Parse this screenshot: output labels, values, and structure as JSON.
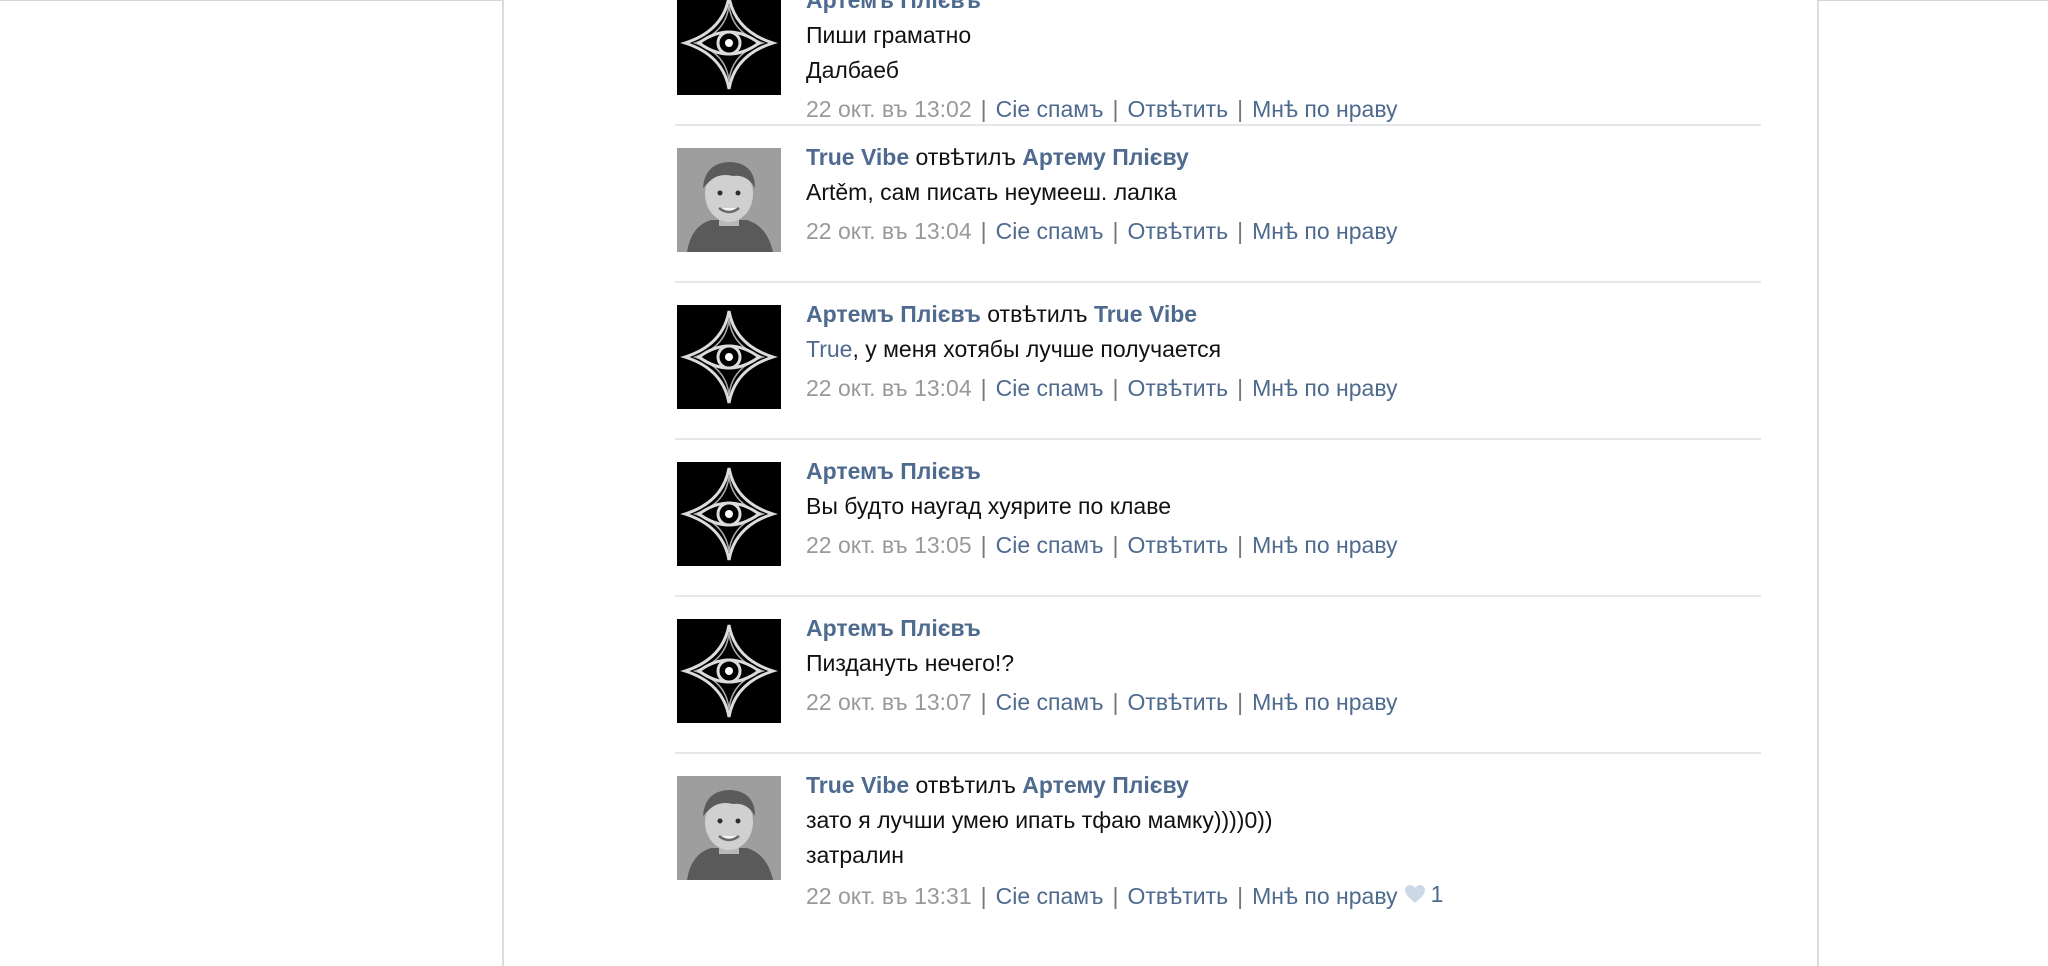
{
  "separator": "|",
  "actions": {
    "spam": "Сіе спамъ",
    "reply": "Отвѣтить",
    "like": "Мнѣ по нраву"
  },
  "comments": [
    {
      "author": "Артемъ Плієвъ",
      "avatar": "star-emblem-icon",
      "lines": [
        "Пиши граматно",
        "Далбаеб"
      ],
      "time": "22 окт. въ 13:02"
    },
    {
      "author": "True Vibe",
      "replied": "отвѣтилъ",
      "target": "Артему Плієву",
      "avatar": "user-photo",
      "lines": [
        "Artěm, сам писать неумееш. лалка"
      ],
      "time": "22 окт. въ 13:04"
    },
    {
      "author": "Артемъ Плієвъ",
      "replied": "отвѣтилъ",
      "target": "True Vibe",
      "avatar": "star-emblem-icon",
      "mention": "True",
      "line_rest": ", у меня хотябы лучше получается",
      "time": "22 окт. въ 13:04"
    },
    {
      "author": "Артемъ Плієвъ",
      "avatar": "star-emblem-icon",
      "lines": [
        "Вы будто наугад хуярите по клаве"
      ],
      "time": "22 окт. въ 13:05"
    },
    {
      "author": "Артемъ Плієвъ",
      "avatar": "star-emblem-icon",
      "lines": [
        "Пиздануть нечего!?"
      ],
      "time": "22 окт. въ 13:07"
    },
    {
      "author": "True Vibe",
      "replied": "отвѣтилъ",
      "target": "Артему Плієву",
      "avatar": "user-photo",
      "lines": [
        "зато я лучши умею ипать тфаю мамку))))0))",
        "затралин"
      ],
      "time": "22 окт. въ 13:31",
      "likes": "1"
    }
  ],
  "colors": {
    "link": "#4e6a8e",
    "text": "#111111",
    "muted": "#999999",
    "divider": "#e4e6ea"
  }
}
